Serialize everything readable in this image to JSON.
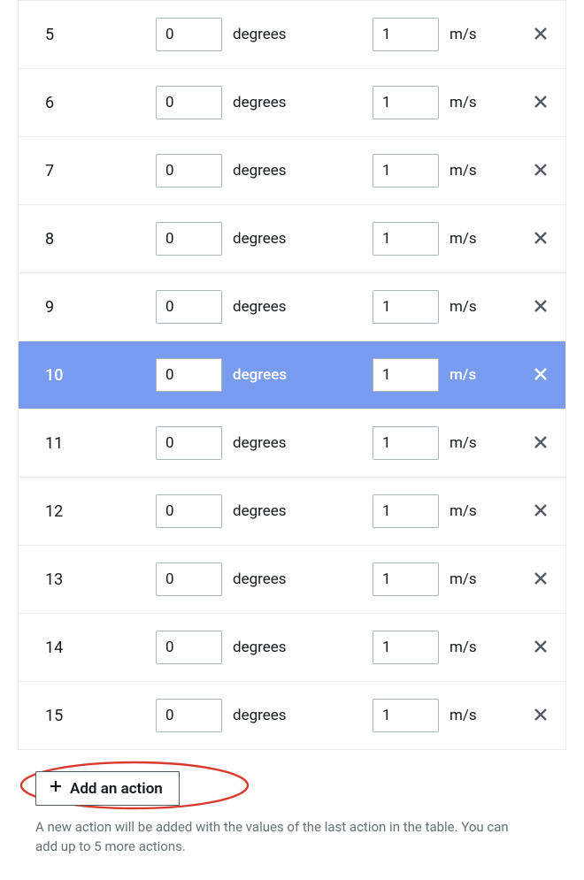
{
  "rows": [
    {
      "index": "5",
      "degrees": "0",
      "speed": "1",
      "selected": false
    },
    {
      "index": "6",
      "degrees": "0",
      "speed": "1",
      "selected": false
    },
    {
      "index": "7",
      "degrees": "0",
      "speed": "1",
      "selected": false
    },
    {
      "index": "8",
      "degrees": "0",
      "speed": "1",
      "selected": false
    },
    {
      "index": "9",
      "degrees": "0",
      "speed": "1",
      "selected": false
    },
    {
      "index": "10",
      "degrees": "0",
      "speed": "1",
      "selected": true
    },
    {
      "index": "11",
      "degrees": "0",
      "speed": "1",
      "selected": false
    },
    {
      "index": "12",
      "degrees": "0",
      "speed": "1",
      "selected": false
    },
    {
      "index": "13",
      "degrees": "0",
      "speed": "1",
      "selected": false
    },
    {
      "index": "14",
      "degrees": "0",
      "speed": "1",
      "selected": false
    },
    {
      "index": "15",
      "degrees": "0",
      "speed": "1",
      "selected": false
    }
  ],
  "units": {
    "degrees": "degrees",
    "speed": "m/s"
  },
  "add_button_label": "Add an action",
  "helper_text": "A new action will be added with the values of the last action in the table. You can add up to 5 more actions.",
  "colors": {
    "selected_row_bg": "#7a9cf0",
    "annotation_ellipse": "#d83a2e"
  }
}
